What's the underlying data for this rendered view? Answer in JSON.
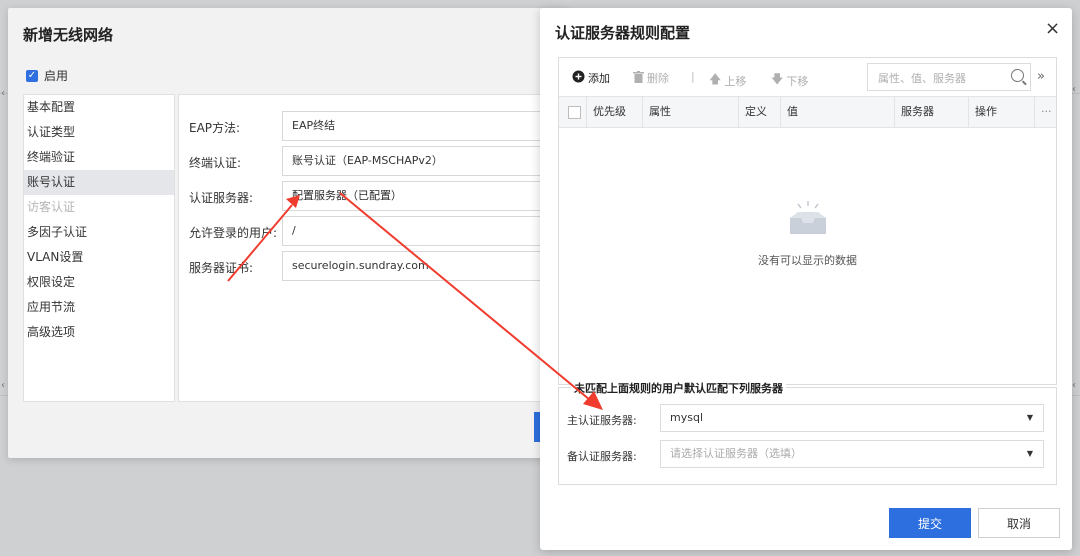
{
  "left_dialog": {
    "title": "新增无线网络",
    "enable_label": "启用",
    "enable_checked": true,
    "nav": [
      {
        "label": "基本配置",
        "state": "normal"
      },
      {
        "label": "认证类型",
        "state": "normal"
      },
      {
        "label": "终端验证",
        "state": "normal"
      },
      {
        "label": "账号认证",
        "state": "active"
      },
      {
        "label": "访客认证",
        "state": "disabled"
      },
      {
        "label": "多因子认证",
        "state": "normal"
      },
      {
        "label": "VLAN设置",
        "state": "normal"
      },
      {
        "label": "权限设定",
        "state": "normal"
      },
      {
        "label": "应用节流",
        "state": "normal"
      },
      {
        "label": "高级选项",
        "state": "normal"
      }
    ],
    "form": {
      "eap_method_label": "EAP方法:",
      "eap_method_value": "EAP终结",
      "terminal_auth_label": "终端认证:",
      "terminal_auth_value": "账号认证（EAP-MSCHAPv2）",
      "auth_server_label": "认证服务器:",
      "auth_server_value": "配置服务器（已配置）",
      "allowed_users_label": "允许登录的用户:",
      "allowed_users_value": "/",
      "server_cert_label": "服务器证书:",
      "server_cert_value": "securelogin.sundray.com"
    }
  },
  "right_dialog": {
    "title": "认证服务器规则配置",
    "close_glyph": "×",
    "toolbar": {
      "add": "添加",
      "delete": "删除",
      "separator": "|",
      "move_up": "上移",
      "move_down": "下移",
      "search_placeholder": "属性、值、服务器",
      "more": "»"
    },
    "table": {
      "columns": [
        "优先级",
        "属性",
        "定义",
        "值",
        "服务器",
        "操作"
      ],
      "more_glyph": "···",
      "rows": [],
      "empty_message": "没有可以显示的数据"
    },
    "fallback": {
      "legend": "未匹配上面规则的用户默认匹配下列服务器",
      "primary_label": "主认证服务器:",
      "primary_value": "mysql",
      "backup_label": "备认证服务器:",
      "backup_placeholder": "请选择认证服务器（选填）"
    },
    "submit": "提交",
    "cancel": "取消"
  },
  "colors": {
    "accent": "#2d6fde",
    "annotation_arrow": "#f03c2e"
  }
}
